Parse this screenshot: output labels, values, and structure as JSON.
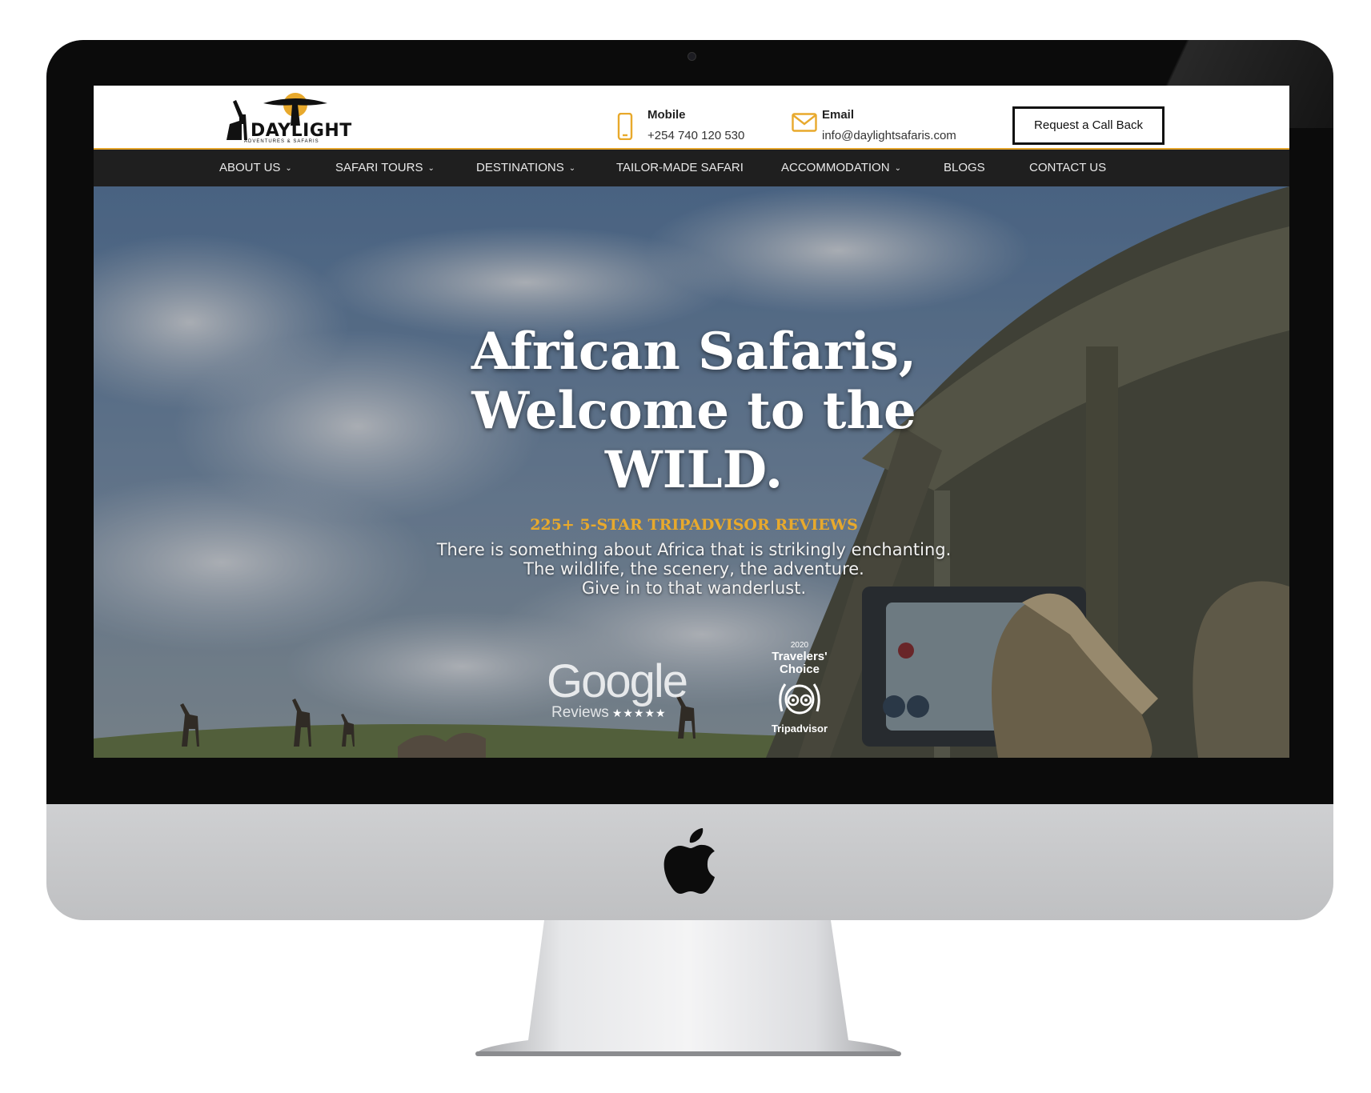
{
  "site": {
    "logo_text": "DAYLIGHT",
    "logo_subtext": "ADVENTURES & SAFARIS",
    "contact": {
      "mobile_label": "Mobile",
      "mobile_value": "+254 740 120 530",
      "email_label": "Email",
      "email_value": "info@daylightsafaris.com"
    },
    "callback_button": "Request a Call Back",
    "nav": [
      {
        "label": "ABOUT US",
        "dropdown": true
      },
      {
        "label": "SAFARI TOURS",
        "dropdown": true
      },
      {
        "label": "DESTINATIONS",
        "dropdown": true
      },
      {
        "label": "TAILOR-MADE SAFARI",
        "dropdown": false
      },
      {
        "label": "ACCOMMODATION",
        "dropdown": true
      },
      {
        "label": "BLOGS",
        "dropdown": false
      },
      {
        "label": "CONTACT US",
        "dropdown": false
      }
    ],
    "hero": {
      "title_line1": "African Safaris,",
      "title_line2": "Welcome to the",
      "title_line3": "WILD.",
      "reviews": "225+ 5-STAR TRIPADVISOR REVIEWS",
      "text_line1": "There is something about Africa that is strikingly enchanting.",
      "text_line2": "The wildlife, the scenery, the adventure.",
      "text_line3": "Give in to that wanderlust."
    },
    "badges": {
      "google_word": "Google",
      "google_sub": "Reviews",
      "google_stars": "★★★★★",
      "ta_year": "2020",
      "ta_line1": "Travelers'",
      "ta_line2": "Choice",
      "ta_name": "Tripadvisor"
    }
  },
  "colors": {
    "accent": "#e8a92c",
    "nav_bg": "#1f1f1f",
    "bezel": "#0b0b0b"
  },
  "icons": [
    "mobile-phone-icon",
    "envelope-icon",
    "chevron-down-icon",
    "apple-logo-icon",
    "tripadvisor-owl-icon"
  ]
}
